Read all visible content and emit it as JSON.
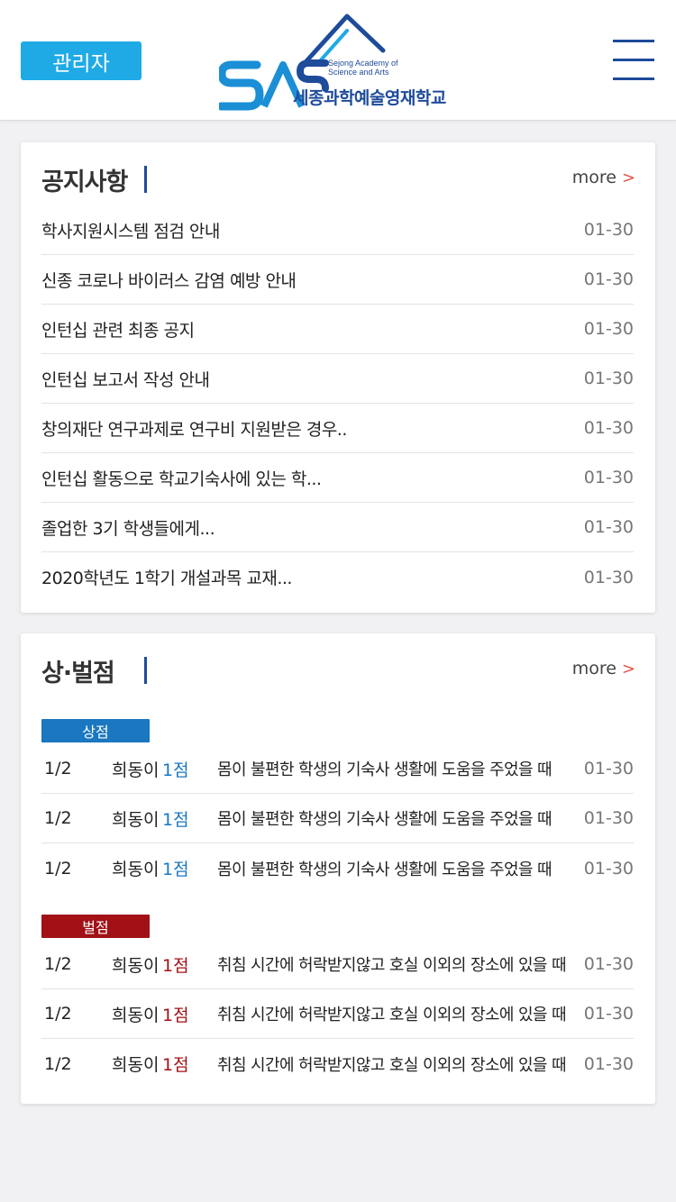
{
  "header": {
    "admin_label": "관리자",
    "logo_en_line1": "Sejong Academy of",
    "logo_en_line2": "Science and Arts",
    "logo_ko": "세종과학예술영재학교",
    "brand_color": "#1e4b9a",
    "admin_color": "#1faae6"
  },
  "notice": {
    "title": "공지사항",
    "more_label": "more",
    "items": [
      {
        "title": "학사지원시스템 점검 안내",
        "date": "01-30"
      },
      {
        "title": "신종 코로나 바이러스 감염 예방 안내",
        "date": "01-30"
      },
      {
        "title": "인턴십 관련 최종 공지",
        "date": "01-30"
      },
      {
        "title": "인턴십 보고서 작성 안내",
        "date": "01-30"
      },
      {
        "title": "창의재단 연구과제로 연구비 지원받은 경우..",
        "date": "01-30"
      },
      {
        "title": "인턴십 활동으로 학교기숙사에 있는 학...",
        "date": "01-30"
      },
      {
        "title": "졸업한 3기 학생들에게...",
        "date": "01-30"
      },
      {
        "title": "2020학년도 1학기 개설과목 교재...",
        "date": "01-30"
      }
    ]
  },
  "points": {
    "title": "상·벌점",
    "more_label": "more",
    "merit_label": "상점",
    "demerit_label": "벌점",
    "merit_color": "#1a77c0",
    "demerit_color": "#a11116",
    "merit": [
      {
        "class": "1/2",
        "name": "희동이",
        "score": "1점",
        "reason": "몸이 불편한 학생의 기숙사 생활에 도움을 주었을 때",
        "date": "01-30"
      },
      {
        "class": "1/2",
        "name": "희동이",
        "score": "1점",
        "reason": "몸이 불편한 학생의 기숙사 생활에 도움을 주었을 때",
        "date": "01-30"
      },
      {
        "class": "1/2",
        "name": "희동이",
        "score": "1점",
        "reason": "몸이 불편한 학생의 기숙사 생활에 도움을 주었을 때",
        "date": "01-30"
      }
    ],
    "demerit": [
      {
        "class": "1/2",
        "name": "희동이",
        "score": "1점",
        "reason": "취침 시간에 허락받지않고 호실 이외의 장소에 있을 때",
        "date": "01-30"
      },
      {
        "class": "1/2",
        "name": "희동이",
        "score": "1점",
        "reason": "취침 시간에 허락받지않고 호실 이외의 장소에 있을 때",
        "date": "01-30"
      },
      {
        "class": "1/2",
        "name": "희동이",
        "score": "1점",
        "reason": "취침 시간에 허락받지않고 호실 이외의 장소에 있을 때",
        "date": "01-30"
      }
    ]
  }
}
